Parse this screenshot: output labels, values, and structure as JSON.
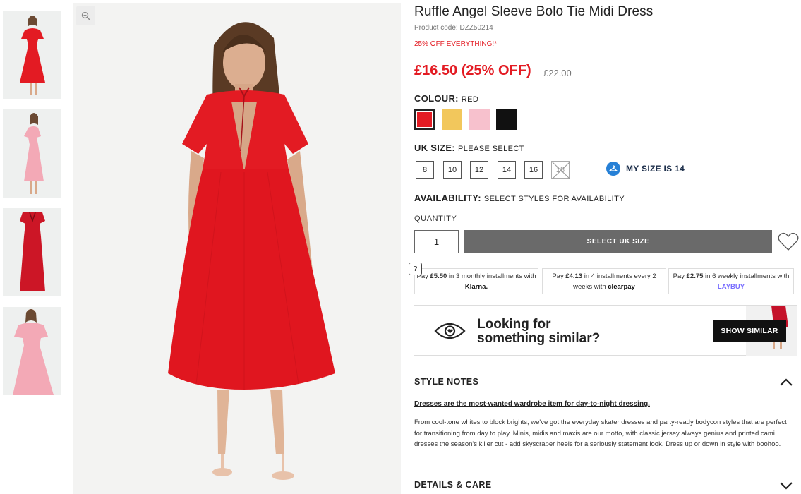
{
  "product": {
    "title": "Ruffle Angel Sleeve Bolo Tie Midi Dress",
    "code": "Product code: DZZ50214",
    "promo": "25% OFF EVERYTHING!*",
    "price_now": "£16.50 (25% OFF)",
    "price_was": "£22.00"
  },
  "colour": {
    "label": "COLOUR:",
    "value": "RED",
    "swatches": [
      {
        "name": "red",
        "color": "#e31b23",
        "selected": true
      },
      {
        "name": "yellow",
        "color": "#f2c75c",
        "selected": false
      },
      {
        "name": "pink",
        "color": "#f7c1cd",
        "selected": false
      },
      {
        "name": "black",
        "color": "#111111",
        "selected": false
      }
    ]
  },
  "size": {
    "label": "UK SIZE:",
    "value": "PLEASE SELECT",
    "options": [
      {
        "label": "8",
        "available": true
      },
      {
        "label": "10",
        "available": true
      },
      {
        "label": "12",
        "available": true
      },
      {
        "label": "14",
        "available": true
      },
      {
        "label": "16",
        "available": true
      },
      {
        "label": "18",
        "available": false
      }
    ],
    "my_size": "MY SIZE IS 14"
  },
  "availability": {
    "label": "AVAILABILITY:",
    "value": "SELECT STYLES FOR AVAILABILITY"
  },
  "quantity": {
    "label": "QUANTITY",
    "value": "1"
  },
  "add_button": "SELECT UK SIZE",
  "help": "?",
  "payments": [
    {
      "pre": "Pay ",
      "amount": "£5.50",
      "mid": " in 3 monthly installments with ",
      "brand": "Klarna."
    },
    {
      "pre": "Pay ",
      "amount": "£4.13",
      "mid": " in 4 installments every 2 weeks with ",
      "brand": "clearpay"
    },
    {
      "pre": "Pay ",
      "amount": "£2.75",
      "mid": " in 6 weekly installments with ",
      "brand": "LAYBUY"
    }
  ],
  "similar": {
    "line1": "Looking for",
    "line2": "something similar?",
    "button": "SHOW SIMILAR"
  },
  "style_notes": {
    "header": "STYLE NOTES",
    "headline": "Dresses are the most-wanted wardrobe item for day-to-night dressing.",
    "body": "From cool-tone whites to block brights, we've got the everyday skater dresses and party-ready bodycon styles that are perfect for transitioning from day to play. Minis, midis and maxis are our motto, with classic jersey always genius and printed cami dresses the season's killer cut - add skyscraper heels for a seriously statement look. Dress up or down in style with boohoo."
  },
  "details": {
    "header": "DETAILS & CARE"
  },
  "colors": {
    "accent": "#e31b23",
    "button_grey": "#6a6a6a",
    "info_blue": "#2680d6"
  }
}
